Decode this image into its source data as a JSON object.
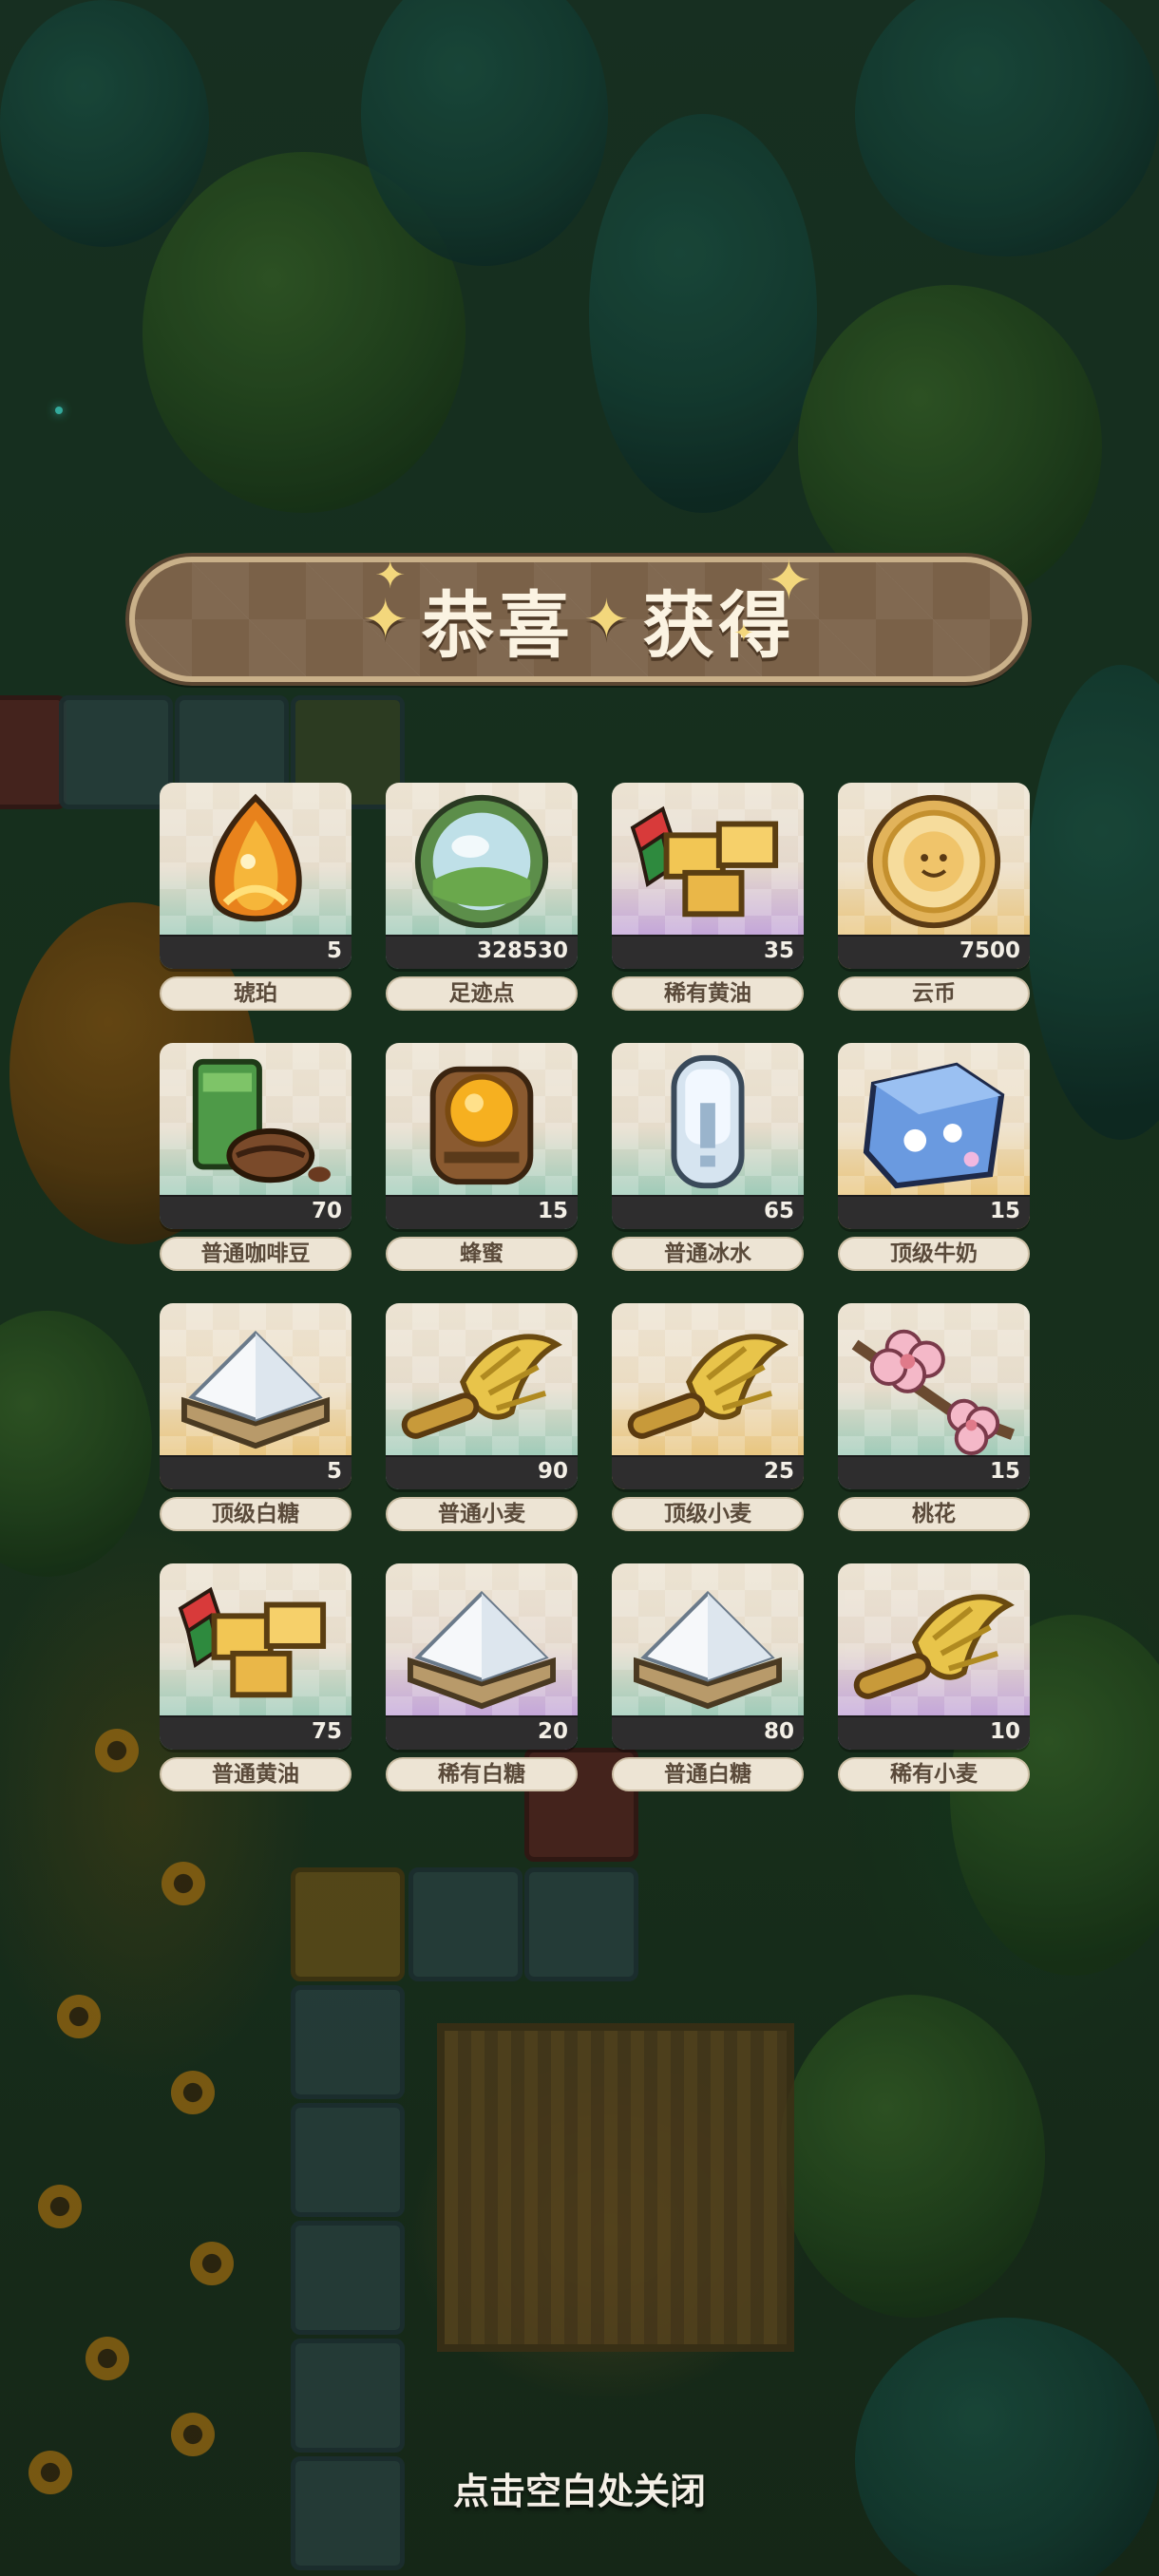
{
  "dialog": {
    "title_part1": "恭喜",
    "title_part2": "获得",
    "close_hint": "点击空白处关闭"
  },
  "rewards": [
    {
      "name": "琥珀",
      "quantity": "5",
      "tier": "normal",
      "icon": "amber-icon"
    },
    {
      "name": "足迹点",
      "quantity": "328530",
      "tier": "normal",
      "icon": "footprint-orb-icon"
    },
    {
      "name": "稀有黄油",
      "quantity": "35",
      "tier": "rare",
      "icon": "butter-icon"
    },
    {
      "name": "云币",
      "quantity": "7500",
      "tier": "top",
      "icon": "cloud-coin-icon"
    },
    {
      "name": "普通咖啡豆",
      "quantity": "70",
      "tier": "normal",
      "icon": "coffee-bean-icon"
    },
    {
      "name": "蜂蜜",
      "quantity": "15",
      "tier": "normal",
      "icon": "honey-icon"
    },
    {
      "name": "普通冰水",
      "quantity": "65",
      "tier": "normal",
      "icon": "ice-water-icon"
    },
    {
      "name": "顶级牛奶",
      "quantity": "15",
      "tier": "top",
      "icon": "milk-carton-icon"
    },
    {
      "name": "顶级白糖",
      "quantity": "5",
      "tier": "top",
      "icon": "sugar-icon"
    },
    {
      "name": "普通小麦",
      "quantity": "90",
      "tier": "normal",
      "icon": "wheat-icon"
    },
    {
      "name": "顶级小麦",
      "quantity": "25",
      "tier": "top",
      "icon": "wheat-icon"
    },
    {
      "name": "桃花",
      "quantity": "15",
      "tier": "normal",
      "icon": "peach-blossom-icon"
    },
    {
      "name": "普通黄油",
      "quantity": "75",
      "tier": "normal",
      "icon": "butter-icon"
    },
    {
      "name": "稀有白糖",
      "quantity": "20",
      "tier": "rare",
      "icon": "sugar-icon"
    },
    {
      "name": "普通白糖",
      "quantity": "80",
      "tier": "normal",
      "icon": "sugar-icon"
    },
    {
      "name": "稀有小麦",
      "quantity": "10",
      "tier": "rare",
      "icon": "wheat-icon"
    }
  ],
  "colors": {
    "tier_normal": "#7cc3b0",
    "tier_rare": "#b48ee0",
    "tier_top": "#e8bb5e",
    "banner": "#7a6148"
  }
}
